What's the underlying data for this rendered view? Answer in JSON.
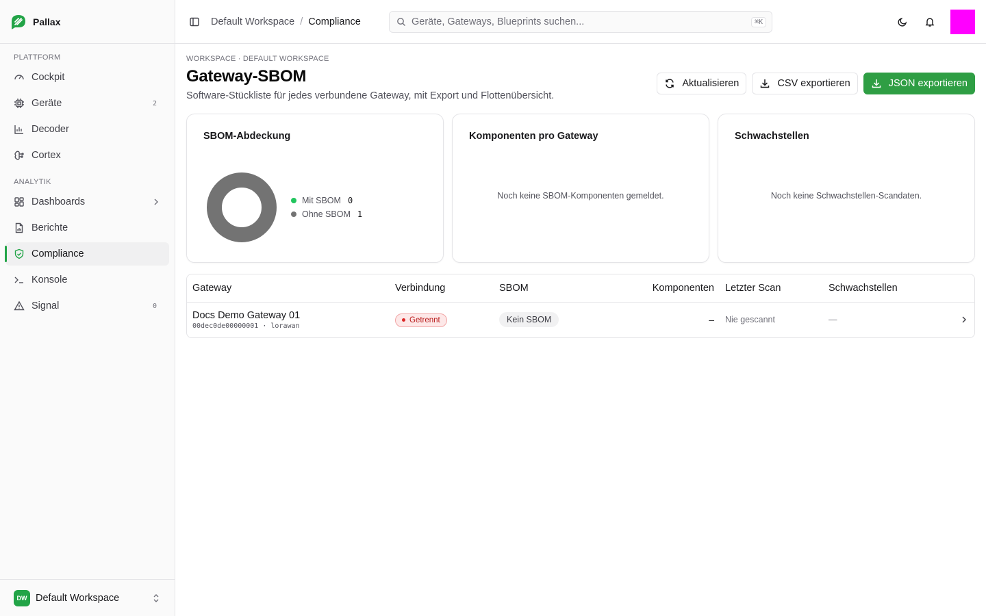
{
  "brand": {
    "name": "Pallax",
    "accent": "#22a447"
  },
  "sidebar": {
    "groups": [
      {
        "label": "PLATTFORM"
      },
      {
        "label": "ANALYTIK"
      }
    ],
    "items": [
      {
        "label": "Cockpit",
        "icon": "gauge-icon"
      },
      {
        "label": "Geräte",
        "icon": "chip-icon",
        "badge": "2"
      },
      {
        "label": "Decoder",
        "icon": "bar-chart-icon"
      },
      {
        "label": "Cortex",
        "icon": "brain-icon"
      },
      {
        "label": "Dashboards",
        "icon": "layout-icon"
      },
      {
        "label": "Berichte",
        "icon": "report-icon"
      },
      {
        "label": "Compliance",
        "icon": "shield-check-icon",
        "active": true
      },
      {
        "label": "Konsole",
        "icon": "terminal-icon"
      },
      {
        "label": "Signal",
        "icon": "alert-triangle-icon",
        "badge": "0"
      }
    ],
    "workspace": {
      "initials": "DW",
      "name": "Default Workspace"
    }
  },
  "topbar": {
    "breadcrumb": [
      "Default Workspace",
      "Compliance"
    ],
    "separator": "/",
    "search_placeholder": "Geräte, Gateways, Blueprints suchen...",
    "search_shortcut": "⌘K"
  },
  "page": {
    "eyebrow": "WORKSPACE · DEFAULT WORKSPACE",
    "title": "Gateway-SBOM",
    "subtitle": "Software-Stückliste für jedes verbundene Gateway, mit Export und Flottenübersicht.",
    "actions": {
      "refresh": "Aktualisieren",
      "csv": "CSV exportieren",
      "json": "JSON exportieren"
    }
  },
  "cards": {
    "coverage": {
      "title": "SBOM-Abdeckung",
      "legend": [
        {
          "label": "Mit SBOM",
          "value": 0,
          "color": "#22c55e"
        },
        {
          "label": "Ohne SBOM",
          "value": 1,
          "color": "#737373"
        }
      ]
    },
    "components": {
      "title": "Komponenten pro Gateway",
      "empty": "Noch keine SBOM-Komponenten gemeldet."
    },
    "vulns": {
      "title": "Schwachstellen",
      "empty": "Noch keine Schwachstellen-Scandaten."
    }
  },
  "table": {
    "headers": [
      "Gateway",
      "Verbindung",
      "SBOM",
      "Komponenten",
      "Letzter Scan",
      "Schwachstellen"
    ],
    "rows": [
      {
        "name": "Docs Demo Gateway 01",
        "meta": "00dec0de00000001 · lorawan",
        "connection": "Getrennt",
        "sbom": "Kein SBOM",
        "components": "–",
        "last_scan": "Nie gescannt",
        "vulns": "—"
      }
    ]
  }
}
